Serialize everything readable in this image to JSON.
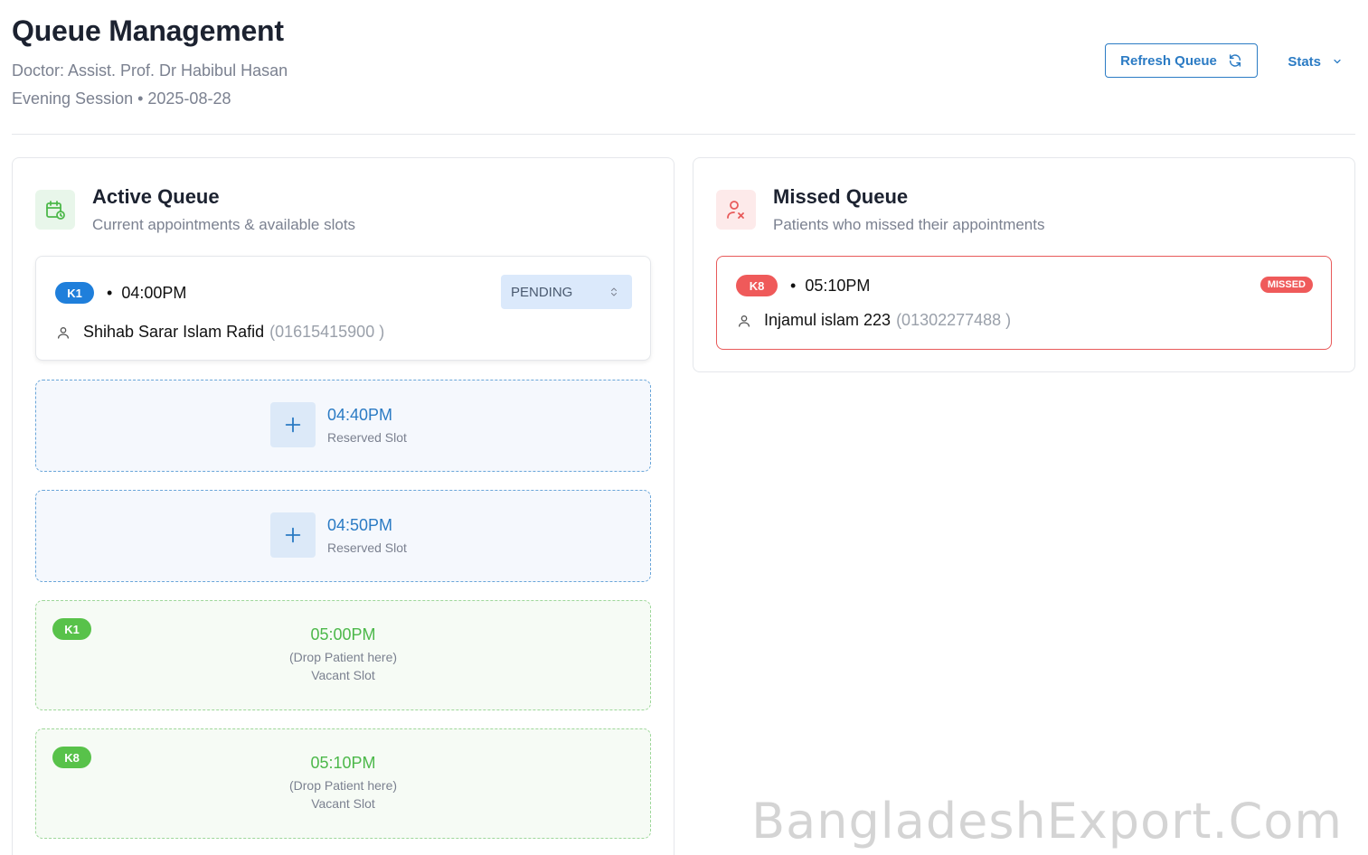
{
  "header": {
    "title": "Queue Management",
    "doctor_line": "Doctor: Assist. Prof. Dr Habibul Hasan",
    "session_line": "Evening Session • 2025-08-28",
    "refresh_label": "Refresh Queue",
    "stats_label": "Stats"
  },
  "active_queue": {
    "title": "Active Queue",
    "subtitle": "Current appointments & available slots",
    "appointment": {
      "badge": "K1",
      "time": "04:00PM",
      "status": "PENDING",
      "patient_name": "Shihab Sarar Islam Rafid",
      "patient_phone": "(01615415900 )"
    },
    "reserved_slots": [
      {
        "time": "04:40PM",
        "label": "Reserved Slot"
      },
      {
        "time": "04:50PM",
        "label": "Reserved Slot"
      }
    ],
    "vacant_slots": [
      {
        "badge": "K1",
        "time": "05:00PM",
        "hint": "(Drop Patient here)",
        "label": "Vacant Slot"
      },
      {
        "badge": "K8",
        "time": "05:10PM",
        "hint": "(Drop Patient here)",
        "label": "Vacant Slot"
      }
    ]
  },
  "missed_queue": {
    "title": "Missed Queue",
    "subtitle": "Patients who missed their appointments",
    "appointment": {
      "badge": "K8",
      "time": "05:10PM",
      "tag": "MISSED",
      "patient_name": "Injamul islam 223",
      "patient_phone": "(01302277488 )"
    }
  },
  "watermark": "BangladeshExport.Com",
  "colors": {
    "accent_blue": "#2b7bc4",
    "badge_blue": "#1f7fdb",
    "missed_red": "#ef5a5a",
    "vacant_green": "#4cb84a"
  },
  "icons": {
    "refresh": "refresh-icon",
    "stats": "chevron-down-icon",
    "active": "calendar-clock-icon",
    "missed": "user-x-icon",
    "patient": "user-icon",
    "reserve": "plus-icon",
    "status": "updown-chevron-icon"
  }
}
